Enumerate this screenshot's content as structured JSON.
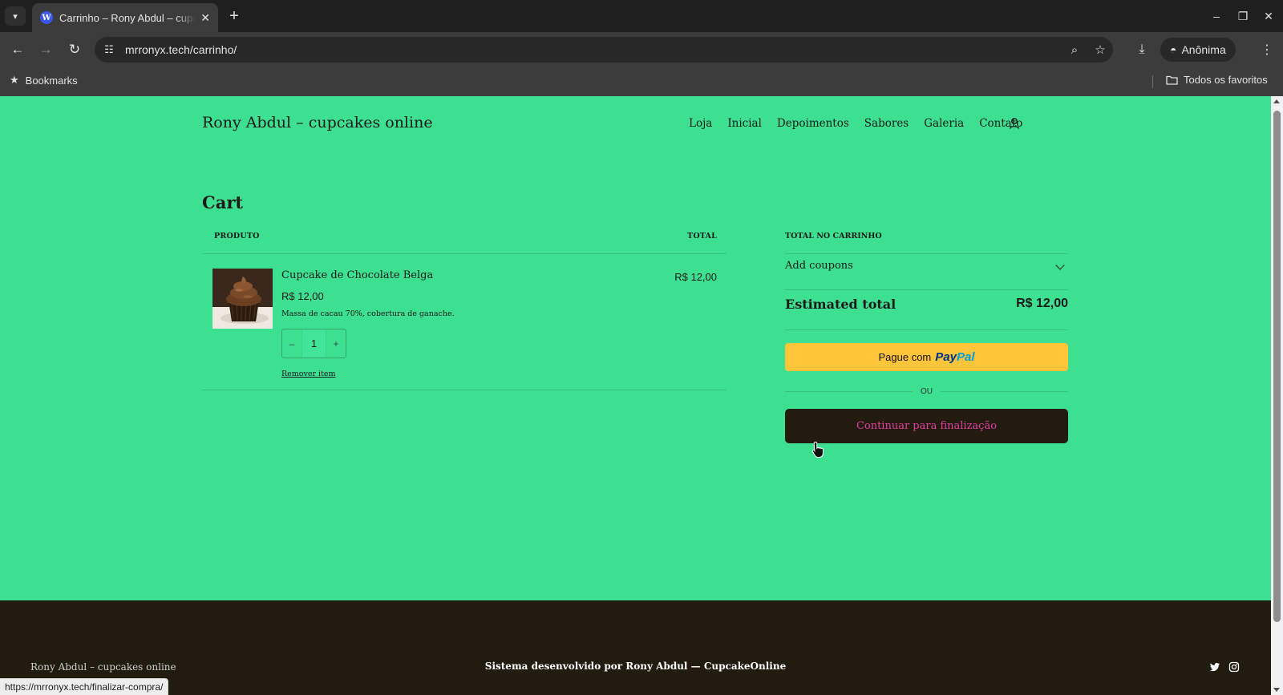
{
  "browser": {
    "tab_title": "Carrinho – Rony Abdul – cupcakes online",
    "url": "mrronyx.tech/carrinho/",
    "profile_label": "Anônima",
    "bookmarks_label": "Bookmarks",
    "all_bookmarks_label": "Todos os favoritos",
    "status_url": "https://mrronyx.tech/finalizar-compra/"
  },
  "site": {
    "title": "Rony Abdul – cupcakes online",
    "nav": [
      "Loja",
      "Inicial",
      "Depoimentos",
      "Sabores",
      "Galeria",
      "Contato"
    ]
  },
  "cart": {
    "heading": "Cart",
    "col_product": "PRODUTO",
    "col_total": "TOTAL",
    "item": {
      "name": "Cupcake de Chocolate Belga",
      "price": "R$ 12,00",
      "description": "Massa de cacau 70%, cobertura de ganache.",
      "quantity": "1",
      "minus": "–",
      "plus": "+",
      "remove_label": "Remover item",
      "line_total": "R$ 12,00"
    }
  },
  "totals": {
    "heading": "TOTAL NO CARRINHO",
    "coupons_label": "Add coupons",
    "estimated_label": "Estimated total",
    "estimated_value": "R$ 12,00",
    "paypal_prefix": "Pague com",
    "paypal_logo_pay": "Pay",
    "paypal_logo_pal": "Pal",
    "separator": "OU",
    "checkout_label": "Continuar para finalização"
  },
  "footer": {
    "left_text": "Rony Abdul – cupcakes online",
    "center_text": "Sistema desenvolvido por Rony Abdul — CupcakeOnline"
  },
  "colors": {
    "page_background": "#3ddf90",
    "footer_background": "#221b0f",
    "checkout_text": "#e43fa3",
    "paypal_button": "#ffc439"
  }
}
